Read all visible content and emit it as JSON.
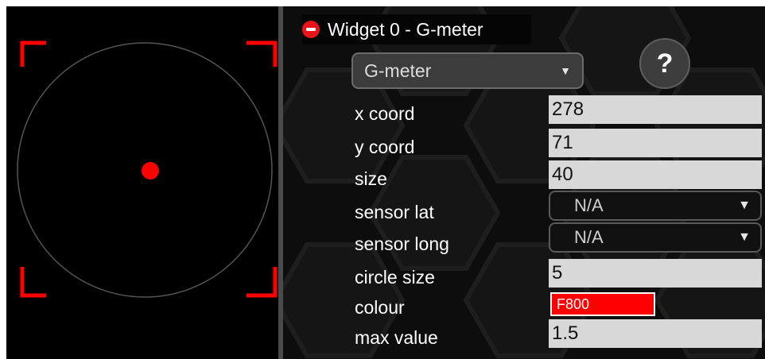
{
  "preview": {
    "corner_color": "#ff0000",
    "dot_color": "#ff0000",
    "circle_color": "#555555"
  },
  "widget": {
    "title": "Widget 0 - G-meter",
    "type_value": "G-meter",
    "help_label": "?"
  },
  "fields": {
    "x_coord": {
      "label": "x coord",
      "value": "278"
    },
    "y_coord": {
      "label": "y coord",
      "value": "71"
    },
    "size": {
      "label": "size",
      "value": "40"
    },
    "sensor_lat": {
      "label": "sensor lat",
      "value": "N/A"
    },
    "sensor_long": {
      "label": "sensor long",
      "value": "N/A"
    },
    "circle_size": {
      "label": "circle size",
      "value": "5"
    },
    "colour": {
      "label": "colour",
      "value": "F800"
    },
    "max_value": {
      "label": "max value",
      "value": "1.5"
    }
  },
  "icons": {
    "remove": "remove-circle-icon",
    "dropdown": "chevron-down-icon"
  },
  "colors": {
    "accent_red": "#ff0000",
    "panel_bg": "#0d0d0d"
  }
}
